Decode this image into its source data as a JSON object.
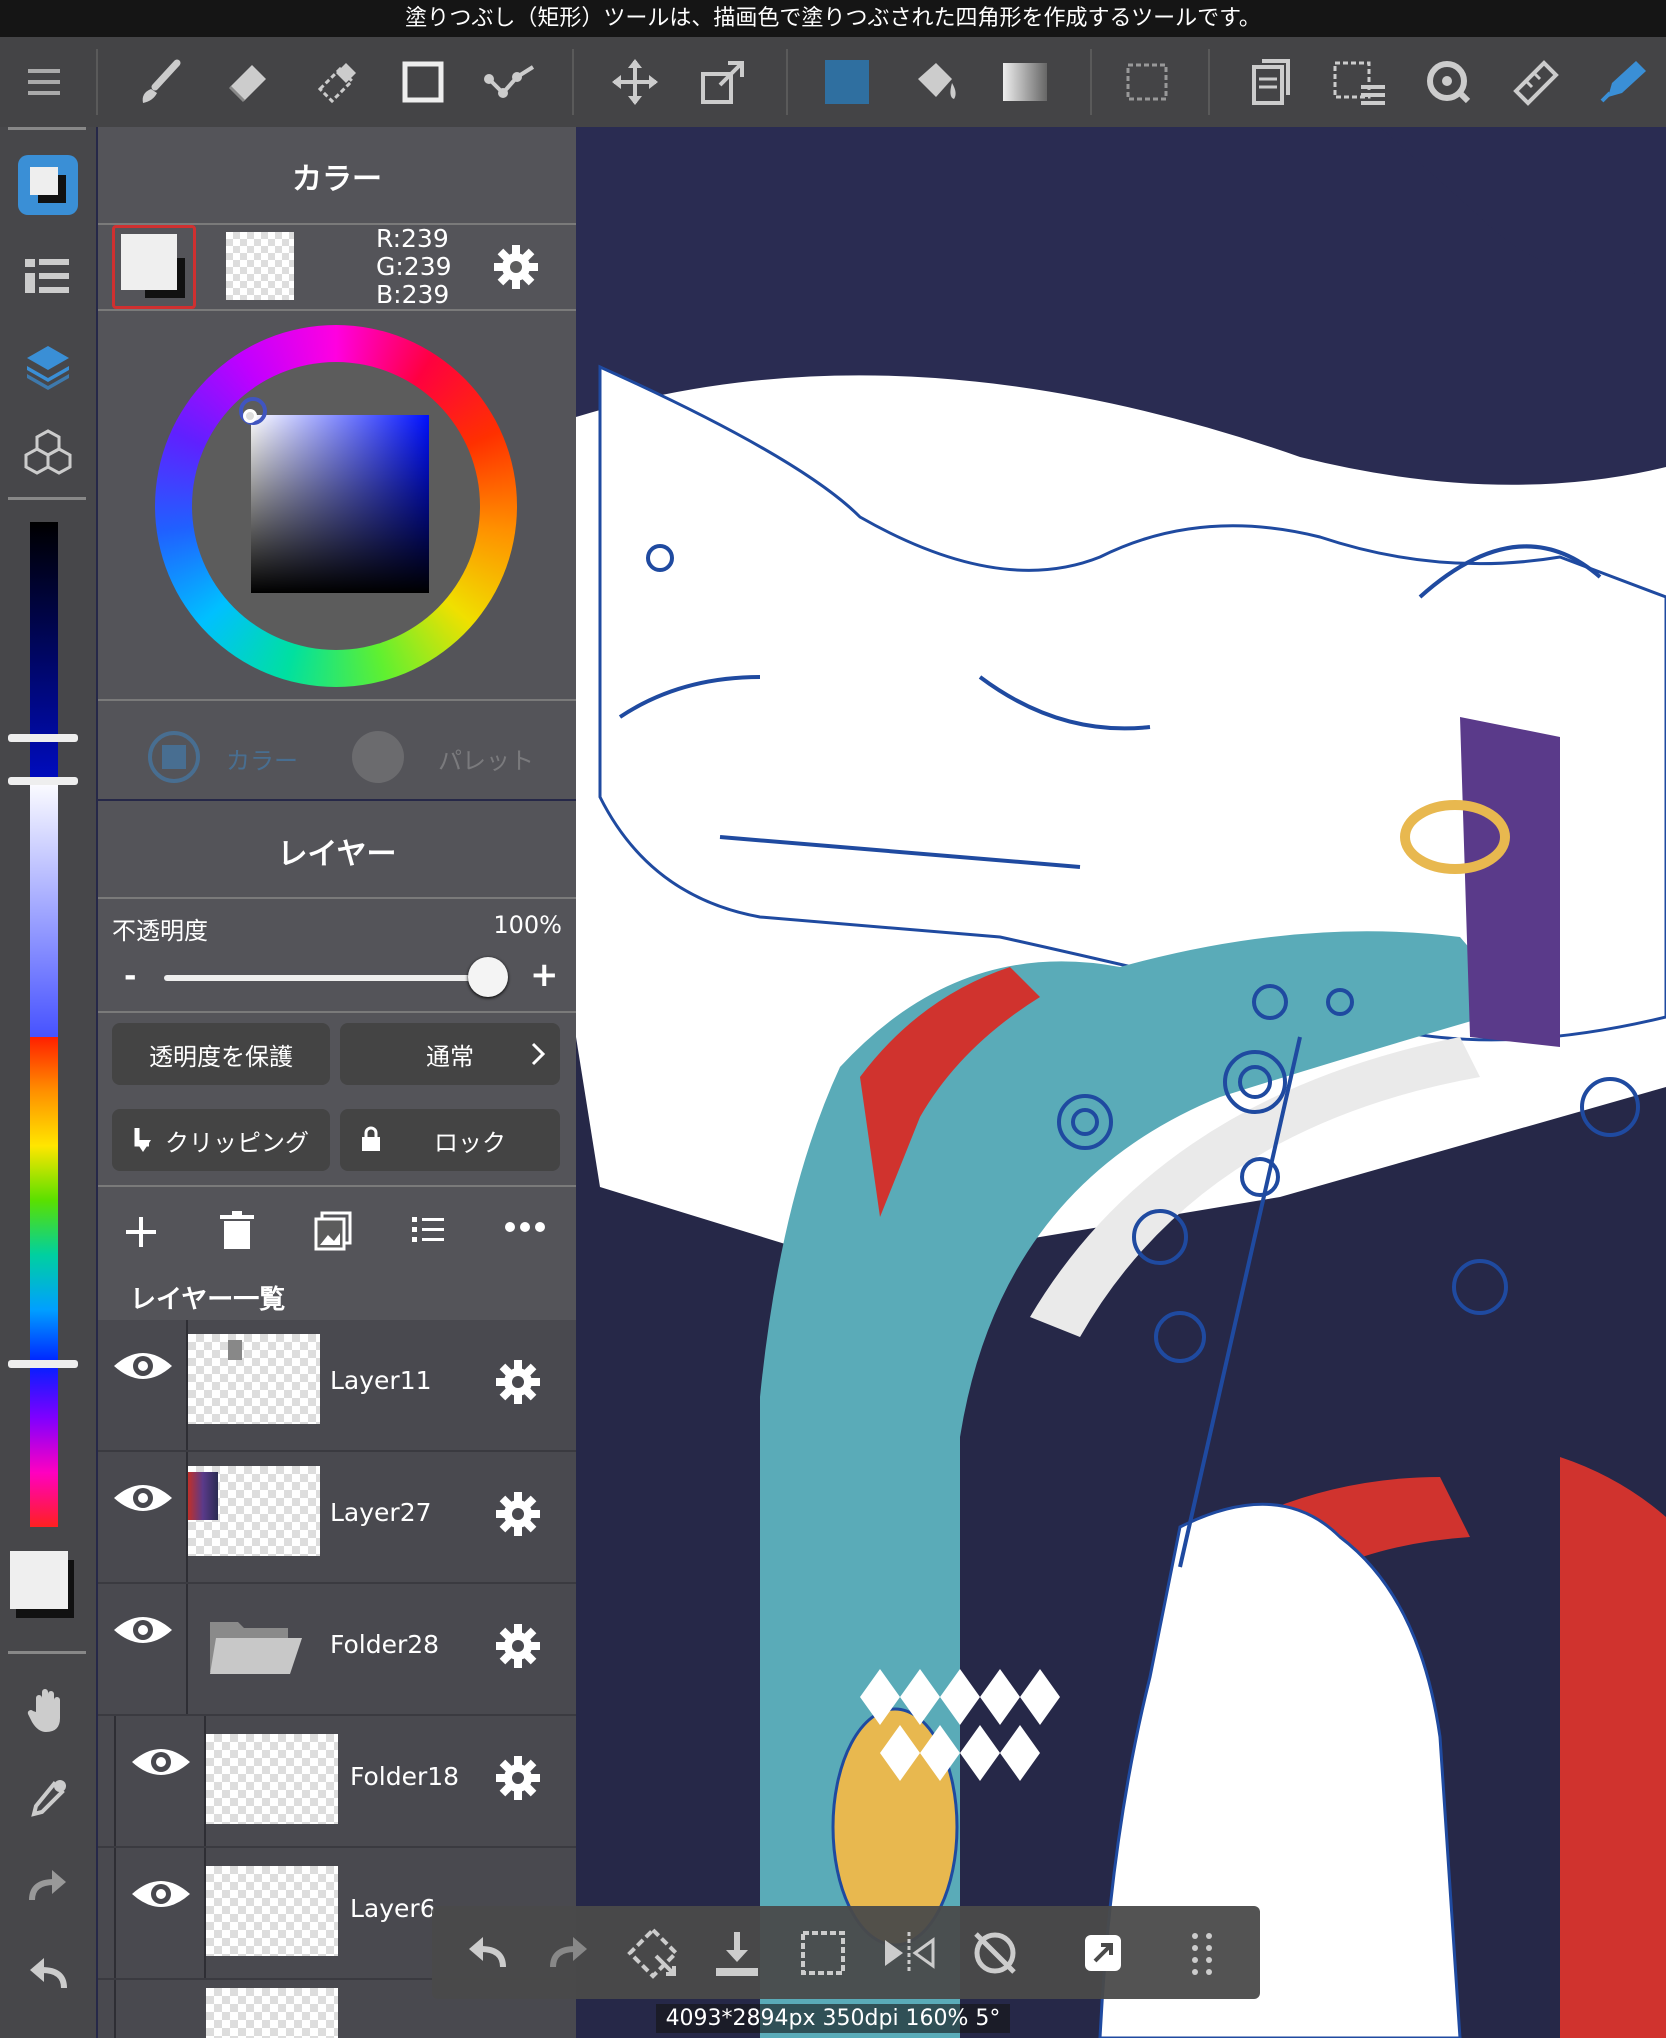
{
  "hint": "塗りつぶし（矩形）ツールは、描画色で塗りつぶされた四角形を作成するツールです。",
  "toolbar": {
    "icons": [
      "menu-icon",
      "brush-icon",
      "eraser-icon",
      "blur-eraser-icon",
      "rectangle-icon",
      "polyline-icon",
      "move-icon",
      "transform-icon",
      "fill-color-swatch",
      "bucket-icon",
      "gradient-icon",
      "selection-icon",
      "layers-copy-icon",
      "select-list-icon",
      "lasso-icon",
      "ruler-icon",
      "pen-icon"
    ],
    "colors": {
      "active": "#3a8fd6",
      "fill_swatch": "#2f6fa0"
    }
  },
  "rail": {
    "icons": [
      "color-panel-icon",
      "brush-list-icon",
      "layers-icon",
      "materials-icon",
      "hand-icon",
      "eyedropper-icon",
      "redo-icon",
      "undo-icon"
    ],
    "foreground_color": "#efefef"
  },
  "color_panel": {
    "title": "カラー",
    "r": "R:239",
    "g": "G:239",
    "b": "B:239",
    "tab_color": "カラー",
    "tab_palette": "パレット"
  },
  "layer_panel": {
    "title": "レイヤー",
    "opacity_label": "不透明度",
    "opacity_value": "100%",
    "opacity_minus": "-",
    "opacity_plus": "+",
    "opacity_fraction": 1.0,
    "protect_alpha": "透明度を保護",
    "blend_mode": "通常",
    "clipping": "クリッピング",
    "lock": "ロック",
    "list_title": "レイヤー一覧",
    "layers": [
      {
        "name": "Layer11",
        "type": "layer"
      },
      {
        "name": "Layer27",
        "type": "layer"
      },
      {
        "name": "Folder28",
        "type": "folder"
      },
      {
        "name": "Folder18",
        "type": "layer"
      },
      {
        "name": "Layer6",
        "type": "layer"
      }
    ]
  },
  "bottom_bar": {
    "icons": [
      "undo-icon",
      "redo-icon",
      "transform-select-icon",
      "save-icon",
      "select-all-icon",
      "flip-icon",
      "rotate-reset-icon",
      "share-icon",
      "grid-icon"
    ]
  },
  "status": "4093*2894px 350dpi 160% 5°"
}
